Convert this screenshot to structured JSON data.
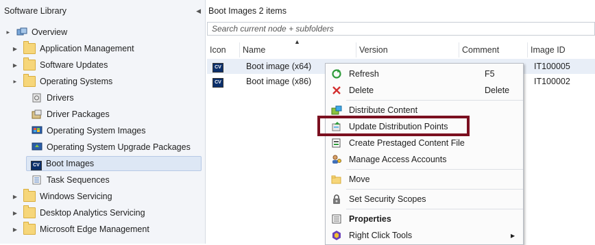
{
  "left": {
    "title": "Software Library",
    "tree": [
      {
        "label": "Overview",
        "icon": "overview-icon",
        "expander": "▲"
      },
      {
        "label": "Application Management",
        "icon": "folder-icon",
        "expander": "▶"
      },
      {
        "label": "Software Updates",
        "icon": "folder-icon",
        "expander": "▶"
      },
      {
        "label": "Operating Systems",
        "icon": "folder-icon",
        "expander": "▲"
      },
      {
        "label": "Drivers",
        "icon": "drivers-icon"
      },
      {
        "label": "Driver Packages",
        "icon": "driver-packages-icon"
      },
      {
        "label": "Operating System Images",
        "icon": "os-images-icon"
      },
      {
        "label": "Operating System Upgrade Packages",
        "icon": "os-upgrade-icon"
      },
      {
        "label": "Boot Images",
        "icon": "boot-image-icon"
      },
      {
        "label": "Task Sequences",
        "icon": "task-sequence-icon"
      },
      {
        "label": "Windows Servicing",
        "icon": "folder-icon",
        "expander": "▶"
      },
      {
        "label": "Desktop Analytics Servicing",
        "icon": "folder-icon",
        "expander": "▶"
      },
      {
        "label": "Microsoft Edge Management",
        "icon": "folder-icon",
        "expander": "▶"
      }
    ]
  },
  "right": {
    "title": "Boot Images 2 items",
    "search_placeholder": "Search current node + subfolders",
    "columns": [
      "Icon",
      "Name",
      "Version",
      "Comment",
      "Image ID"
    ],
    "rows": [
      {
        "name": "Boot image (x64)",
        "id": "IT100005",
        "icon_text": "CV"
      },
      {
        "name": "Boot image (x86)",
        "id": "IT100002",
        "icon_text": "CV"
      }
    ]
  },
  "menu": {
    "items": [
      {
        "label": "Refresh",
        "shortcut": "F5",
        "icon": "refresh-icon"
      },
      {
        "label": "Delete",
        "shortcut": "Delete",
        "icon": "delete-icon"
      },
      {
        "label": "Distribute Content",
        "icon": "distribute-content-icon"
      },
      {
        "label": "Update Distribution Points",
        "icon": "update-distribution-icon"
      },
      {
        "label": "Create Prestaged Content File",
        "icon": "prestaged-content-icon"
      },
      {
        "label": "Manage Access Accounts",
        "icon": "access-accounts-icon"
      },
      {
        "label": "Move",
        "icon": "move-icon"
      },
      {
        "label": "Set Security Scopes",
        "icon": "security-scopes-icon"
      },
      {
        "label": "Properties",
        "icon": "properties-icon"
      },
      {
        "label": "Right Click Tools",
        "submenu": "▶",
        "icon": "right-click-tools-icon"
      }
    ]
  }
}
